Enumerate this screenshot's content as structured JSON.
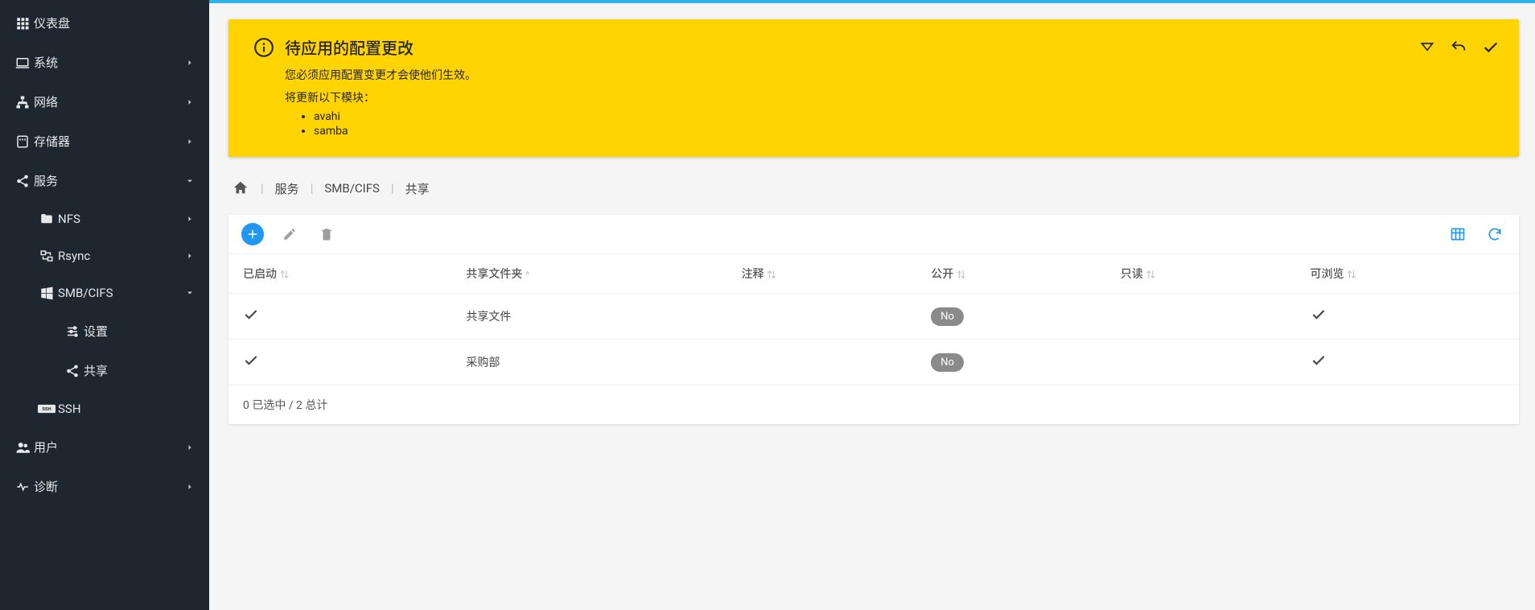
{
  "sidebar": {
    "items": [
      {
        "id": "dashboard",
        "label": "仪表盘",
        "icon": "apps",
        "expandable": false
      },
      {
        "id": "system",
        "label": "系统",
        "icon": "laptop",
        "expandable": true,
        "expanded": false
      },
      {
        "id": "network",
        "label": "网络",
        "icon": "lan",
        "expandable": true,
        "expanded": false
      },
      {
        "id": "storage",
        "label": "存储器",
        "icon": "sd",
        "expandable": true,
        "expanded": false
      },
      {
        "id": "services",
        "label": "服务",
        "icon": "share",
        "expandable": true,
        "expanded": true,
        "children": [
          {
            "id": "nfs",
            "label": "NFS",
            "icon": "folder",
            "expandable": true,
            "expanded": false
          },
          {
            "id": "rsync",
            "label": "Rsync",
            "icon": "sync",
            "expandable": true,
            "expanded": false
          },
          {
            "id": "smb",
            "label": "SMB/CIFS",
            "icon": "windows",
            "expandable": true,
            "expanded": true,
            "children": [
              {
                "id": "settings",
                "label": "设置",
                "icon": "tune"
              },
              {
                "id": "shares",
                "label": "共享",
                "icon": "share2",
                "active": true
              }
            ]
          },
          {
            "id": "ssh",
            "label": "SSH",
            "icon": "ssh",
            "expandable": false
          }
        ]
      },
      {
        "id": "users",
        "label": "用户",
        "icon": "people",
        "expandable": true,
        "expanded": false
      },
      {
        "id": "diag",
        "label": "诊断",
        "icon": "heart",
        "expandable": true,
        "expanded": false
      }
    ]
  },
  "alert": {
    "title": "待应用的配置更改",
    "desc": "您必须应用配置变更才会使他们生效。",
    "sub": "将更新以下模块：",
    "modules": [
      "avahi",
      "samba"
    ]
  },
  "breadcrumbs": {
    "items": [
      "服务",
      "SMB/CIFS",
      "共享"
    ]
  },
  "table": {
    "columns": {
      "enabled": "已启动",
      "folder": "共享文件夹",
      "comment": "注释",
      "public": "公开",
      "readonly": "只读",
      "browseable": "可浏览"
    },
    "public_no": "No",
    "rows": [
      {
        "enabled": true,
        "folder": "共享文件",
        "comment": "",
        "public": false,
        "readonly": "",
        "browseable": true
      },
      {
        "enabled": true,
        "folder": "采购部",
        "comment": "",
        "public": false,
        "readonly": "",
        "browseable": true
      }
    ],
    "footer": "0 已选中 / 2 总计"
  }
}
